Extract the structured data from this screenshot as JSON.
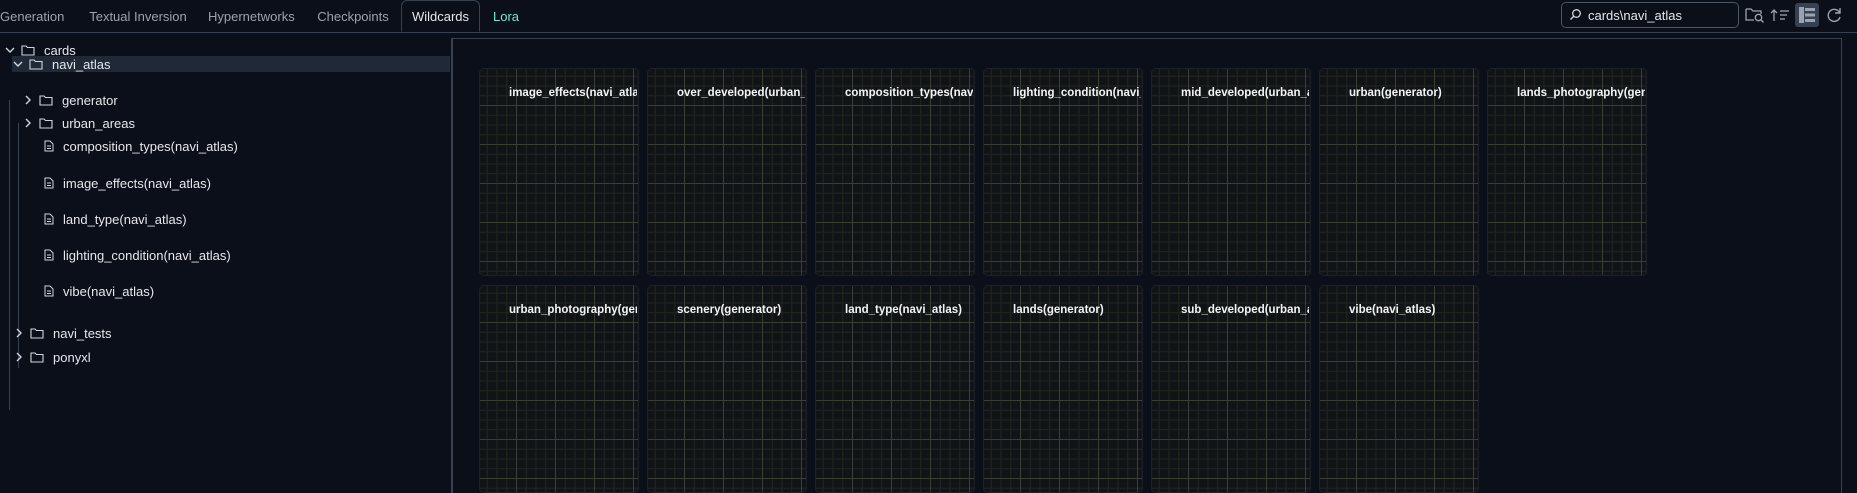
{
  "tabs": [
    {
      "label": "Generation",
      "active": false
    },
    {
      "label": "Textual Inversion",
      "active": false
    },
    {
      "label": "Hypernetworks",
      "active": false
    },
    {
      "label": "Checkpoints",
      "active": false
    },
    {
      "label": "Wildcards",
      "active": true
    },
    {
      "label": "Lora",
      "active": false
    }
  ],
  "search": {
    "value": "cards\\navi_atlas"
  },
  "toolbar": {
    "icons": [
      "search-folder-icon",
      "sort-icon",
      "tree-view-icon",
      "refresh-icon"
    ]
  },
  "tree": {
    "root": "cards",
    "selected": "navi_atlas",
    "children": {
      "navi_atlas": "navi_atlas",
      "generator": "generator",
      "urban_areas": "urban_areas",
      "files": [
        "composition_types(navi_atlas)",
        "image_effects(navi_atlas)",
        "land_type(navi_atlas)",
        "lighting_condition(navi_atlas)",
        "vibe(navi_atlas)"
      ],
      "navi_tests": "navi_tests",
      "ponyxl": "ponyxl"
    }
  },
  "cards": [
    "image_effects(navi_atlas)",
    "over_developed(urban_areas)",
    "composition_types(navi_atlas)",
    "lighting_condition(navi_atlas)",
    "mid_developed(urban_areas)",
    "urban(generator)",
    "lands_photography(generator)",
    "urban_photography(generator)",
    "scenery(generator)",
    "land_type(navi_atlas)",
    "lands(generator)",
    "sub_developed(urban_areas)",
    "vibe(navi_atlas)"
  ],
  "colors": {
    "background": "#0b0f19",
    "border": "#374151",
    "accent_lora": "#6ee7d6",
    "selected_row": "#1f2937"
  }
}
